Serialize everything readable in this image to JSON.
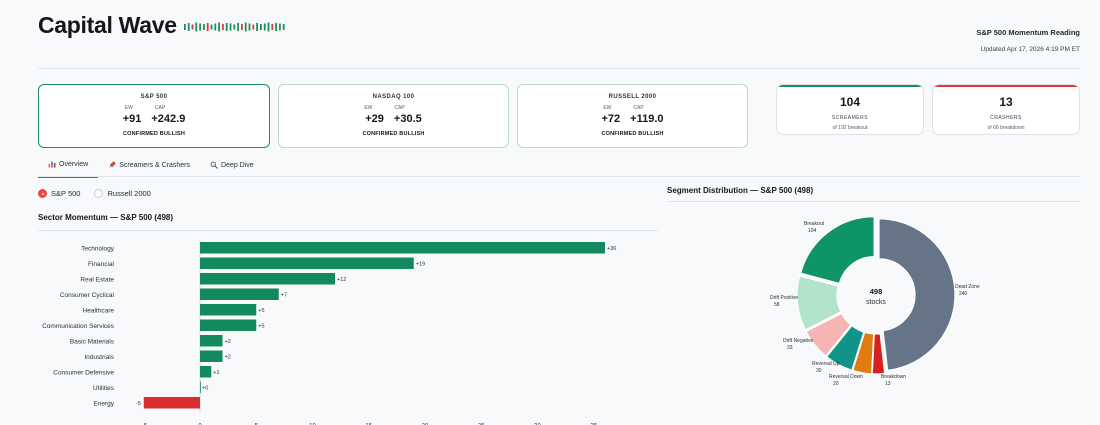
{
  "header": {
    "brand": "Capital Wave",
    "right_title": "S&P 500 Momentum Reading",
    "updated": "Updated Apr 17, 2026 4:19 PM ET",
    "spark_colors": [
      "#1d8f5a",
      "#e23a3a"
    ],
    "spark_pattern": [
      "g",
      "g",
      "r",
      "g",
      "g",
      "g",
      "r",
      "g",
      "g",
      "g",
      "r",
      "g",
      "g",
      "g",
      "g",
      "r",
      "g",
      "g",
      "r",
      "g",
      "g",
      "g",
      "g",
      "r",
      "g",
      "g",
      "g"
    ]
  },
  "index_cards": [
    {
      "title": "S&P 500",
      "ew_label": "EW",
      "cap_label": "CAP",
      "ew": "+91",
      "cap": "+242.9",
      "status": "CONFIRMED BULLISH"
    },
    {
      "title": "NASDAQ 100",
      "ew_label": "EW",
      "cap_label": "CAP",
      "ew": "+29",
      "cap": "+30.5",
      "status": "CONFIRMED BULLISH"
    },
    {
      "title": "RUSSELL 2000",
      "ew_label": "EW",
      "cap_label": "CAP",
      "ew": "+72",
      "cap": "+119.0",
      "status": "CONFIRMED BULLISH"
    }
  ],
  "count_cards": [
    {
      "value": "104",
      "label": "SCREAMERS",
      "sub": "of 192 breakout",
      "accent": "#1d8f5a"
    },
    {
      "value": "13",
      "label": "CRASHERS",
      "sub": "of 66 breakdown",
      "accent": "#e23a3a"
    }
  ],
  "tabs": [
    {
      "label": "Overview",
      "icon": "bar-chart-icon"
    },
    {
      "label": "Screamers & Crashers",
      "icon": "rocket-icon"
    },
    {
      "label": "Deep Dive",
      "icon": "magnifier-icon"
    }
  ],
  "radios": [
    {
      "label": "S&P 500",
      "selected": true
    },
    {
      "label": "Russell 2000",
      "selected": false
    }
  ],
  "sector_title": "Sector Momentum — S&P 500 (498)",
  "segment_title": "Segment Distribution — S&P 500 (498)",
  "chart_data": [
    {
      "type": "bar",
      "orientation": "horizontal",
      "title": "Sector Momentum — S&P 500 (498)",
      "categories": [
        "Technology",
        "Financial",
        "Real Estate",
        "Consumer Cyclical",
        "Healthcare",
        "Communication Services",
        "Basic Materials",
        "Industrials",
        "Consumer Defensive",
        "Utilities",
        "Energy"
      ],
      "values": [
        36,
        19,
        12,
        7,
        5,
        5,
        2,
        2,
        1,
        0,
        -5
      ],
      "labels": [
        "+36",
        "+19",
        "+12",
        "+7",
        "+5",
        "+5",
        "+2",
        "+2",
        "+1",
        "+0",
        "-5"
      ],
      "xlim": [
        -5,
        36
      ],
      "xticks": [
        "−5",
        "0",
        "5",
        "10",
        "15",
        "20",
        "25",
        "30",
        "35"
      ],
      "xtick_values": [
        -5,
        0,
        5,
        10,
        15,
        20,
        25,
        30,
        35
      ],
      "pos_color": "#128a5e",
      "neg_color": "#d92e2e"
    },
    {
      "type": "pie",
      "donut": true,
      "title": "Segment Distribution — S&P 500 (498)",
      "center_value": "498",
      "center_label": "stocks",
      "slices": [
        {
          "label": "Dead Zone",
          "value": 240,
          "color": "#667488"
        },
        {
          "label": "Breakdown",
          "value": 13,
          "color": "#d92020"
        },
        {
          "label": "Reversal Down",
          "value": 20,
          "color": "#e07b10"
        },
        {
          "label": "Reversal Up",
          "value": 30,
          "color": "#119488"
        },
        {
          "label": "Drift Negative",
          "value": 33,
          "color": "#f5b5b5"
        },
        {
          "label": "Drift Positive",
          "value": 58,
          "color": "#b2e4cc"
        },
        {
          "label": "Breakout",
          "value": 104,
          "color": "#0f9466"
        }
      ]
    }
  ]
}
